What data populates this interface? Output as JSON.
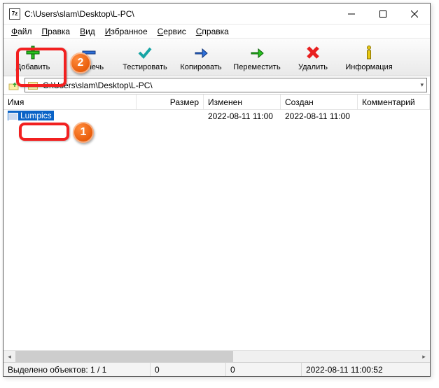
{
  "titlebar": {
    "app_icon_text": "7z",
    "title": "C:\\Users\\slam\\Desktop\\L-PC\\"
  },
  "menu": {
    "file": "Файл",
    "edit": "Правка",
    "view": "Вид",
    "favorites": "Избранное",
    "tools": "Сервис",
    "help": "Справка"
  },
  "toolbar": {
    "add": "Добавить",
    "extract": "Извлечь",
    "test": "Тестировать",
    "copy": "Копировать",
    "move": "Переместить",
    "delete": "Удалить",
    "info": "Информация"
  },
  "address": {
    "path": "C:\\Users\\slam\\Desktop\\L-PC\\"
  },
  "columns": {
    "name": "Имя",
    "size": "Размер",
    "modified": "Изменен",
    "created": "Создан",
    "comment": "Комментарий"
  },
  "rows": [
    {
      "name": "Lumpics",
      "size": "",
      "modified": "2022-08-11 11:00",
      "created": "2022-08-11 11:00",
      "comment": ""
    }
  ],
  "status": {
    "selection": "Выделено объектов: 1 / 1",
    "col2": "0",
    "col3": "0",
    "time": "2022-08-11 11:00:52"
  },
  "annotations": {
    "badge1": "1",
    "badge2": "2"
  }
}
